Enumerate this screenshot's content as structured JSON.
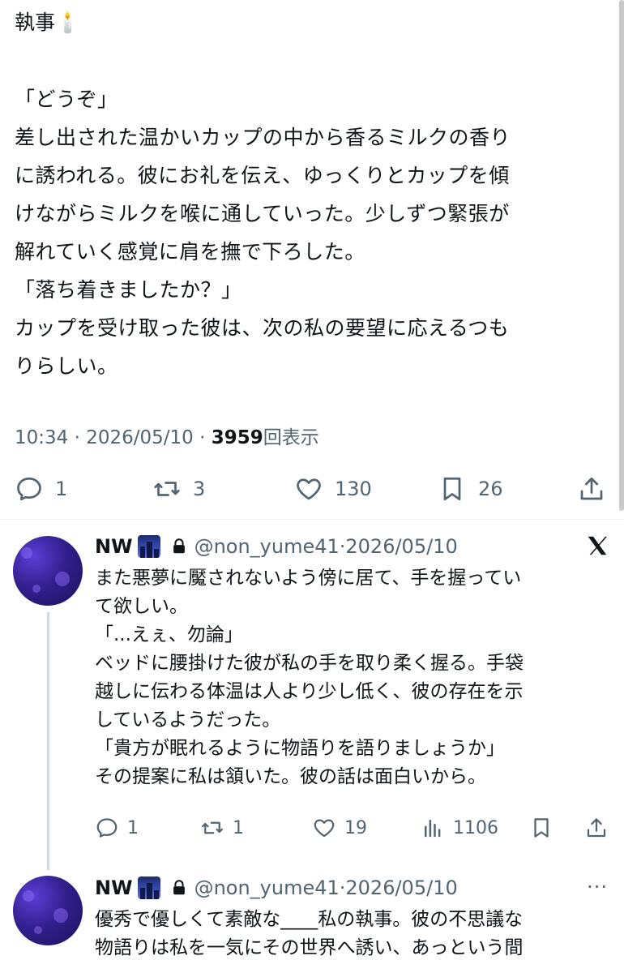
{
  "post": {
    "title": "執事🕯️",
    "body": [
      "「どうぞ」",
      "差し出された温かいカップの中から香るミルクの香り",
      "に誘われる。彼にお礼を伝え、ゆっくりとカップを傾",
      "けながらミルクを喉に通していった。少しずつ緊張が",
      "解れていく感覚に肩を撫で下ろした。",
      "「落ち着きましたか？」",
      "カップを受け取った彼は、次の私の要望に応えるつも",
      "りらしい。"
    ],
    "time": "10:34 · 2026/05/10 · ",
    "views_count": "3959",
    "views_label": "回表示",
    "actions": {
      "replies": "1",
      "reposts": "3",
      "likes": "130",
      "bookmarks": "26"
    }
  },
  "replies": [
    {
      "name": "NW",
      "handle": "@non_yume41·2026/05/10",
      "lines": [
        "また悪夢に魘されないよう傍に居て、手を握ってい",
        "て欲しい。",
        "「...えぇ、勿論」",
        "ベッドに腰掛けた彼が私の手を取り柔く握る。手袋",
        "越しに伝わる体温は人より少し低く、彼の存在を示",
        "しているようだった。",
        "「貴方が眠れるように物語りを語りましょうか」",
        "その提案に私は頷いた。彼の話は面白いから。"
      ],
      "actions": {
        "replies": "1",
        "reposts": "1",
        "likes": "19",
        "views": "1106"
      }
    },
    {
      "name": "NW",
      "handle": "@non_yume41·2026/05/10",
      "lines": [
        "優秀で優しくて素敵な____私の執事。彼の不思議な",
        "物語りは私を一気にその世界へ誘い、あっという間"
      ],
      "more": "···"
    }
  ],
  "icons": {
    "reply": "speech-bubble-icon",
    "repost": "repost-arrows-icon",
    "like": "heart-icon",
    "bookmark": "bookmark-icon",
    "share": "share-upload-icon",
    "views": "bar-chart-icon",
    "x_logo": "x-logo-icon",
    "lock": "lock-icon"
  },
  "colors": {
    "text": "#0f1419",
    "secondary": "#536471",
    "divider": "#eff3f4"
  }
}
